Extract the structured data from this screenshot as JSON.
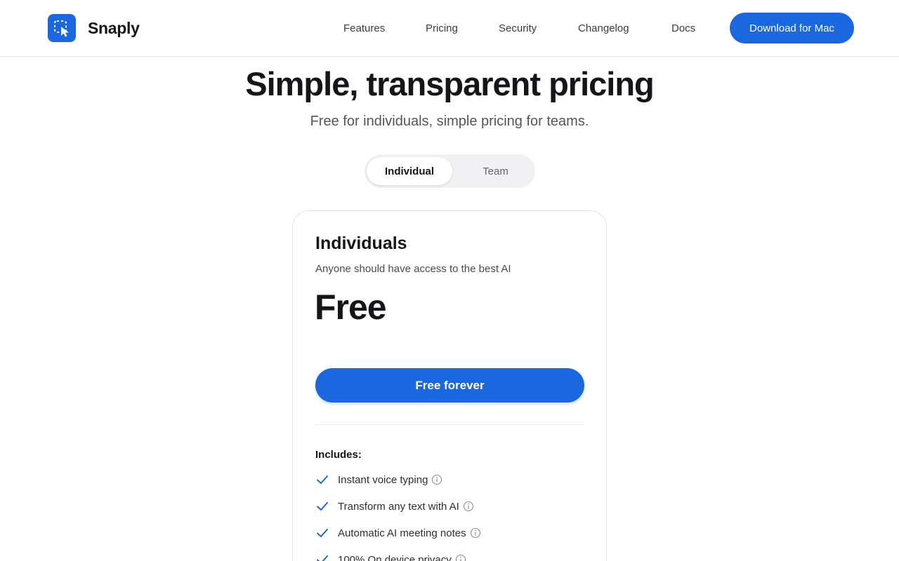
{
  "header": {
    "brand": "Snaply",
    "nav": [
      "Features",
      "Pricing",
      "Security",
      "Changelog",
      "Docs"
    ],
    "download_label": "Download for Mac"
  },
  "hero": {
    "title": "Simple, transparent pricing",
    "subtitle": "Free for individuals, simple pricing for teams."
  },
  "toggle": {
    "options": [
      "Individual",
      "Team"
    ],
    "selected": "Individual"
  },
  "plan": {
    "name": "Individuals",
    "description": "Anyone should have access to the best AI",
    "price": "Free",
    "cta": "Free forever",
    "includes_label": "Includes:",
    "features": [
      "Instant voice typing",
      "Transform any text with AI",
      "Automatic AI meeting notes",
      "100% On device privacy"
    ]
  },
  "colors": {
    "accent": "#1a67e0",
    "text": "#16161a",
    "muted": "#55555c",
    "border": "#e2e2e5"
  },
  "icons": {
    "logo": "cursor-selection-icon",
    "feature_check": "check-icon",
    "feature_info": "info-icon"
  }
}
